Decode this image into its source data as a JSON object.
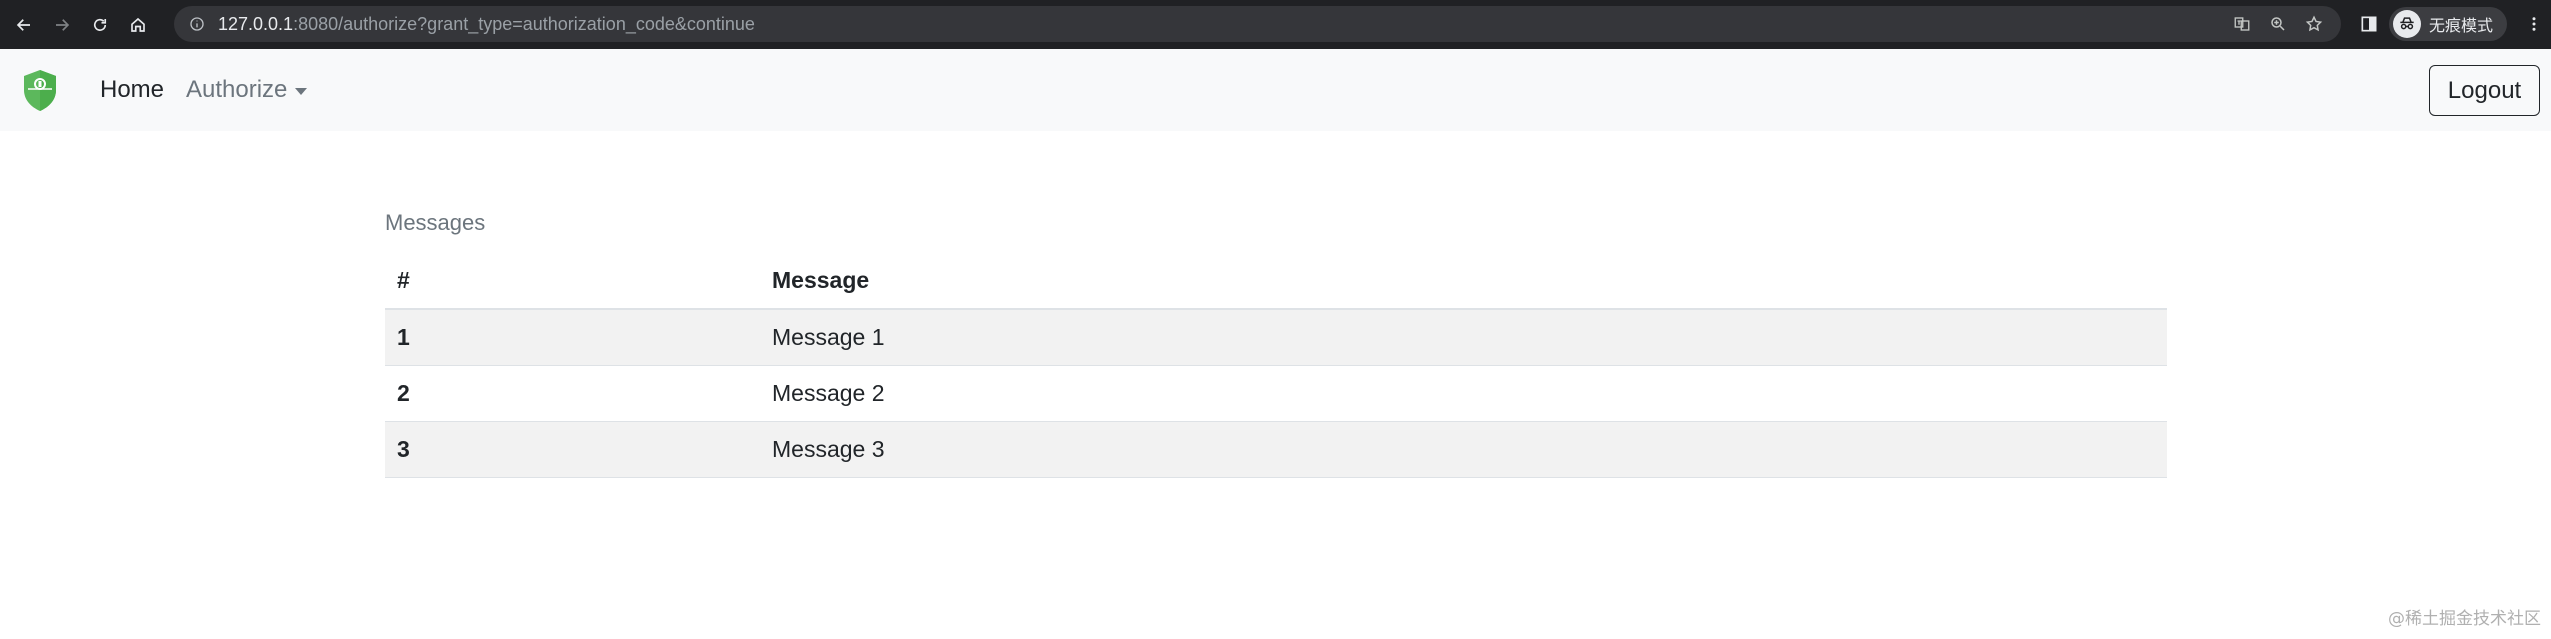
{
  "browser": {
    "url_host": "127.0.0.1",
    "url_rest": ":8080/authorize?grant_type=authorization_code&continue",
    "profile_label": "无痕模式"
  },
  "navbar": {
    "brand_icon": "shield-icon",
    "home_label": "Home",
    "authorize_label": "Authorize",
    "logout_label": "Logout"
  },
  "messages": {
    "caption": "Messages",
    "headers": [
      "#",
      "Message"
    ],
    "rows": [
      {
        "id": "1",
        "message": "Message 1"
      },
      {
        "id": "2",
        "message": "Message 2"
      },
      {
        "id": "3",
        "message": "Message 3"
      }
    ]
  },
  "watermark": "@稀土掘金技术社区",
  "colors": {
    "brand_green": "#5cb85c",
    "navbar_bg": "#f8f9fa",
    "stripe": "#f2f2f2"
  }
}
